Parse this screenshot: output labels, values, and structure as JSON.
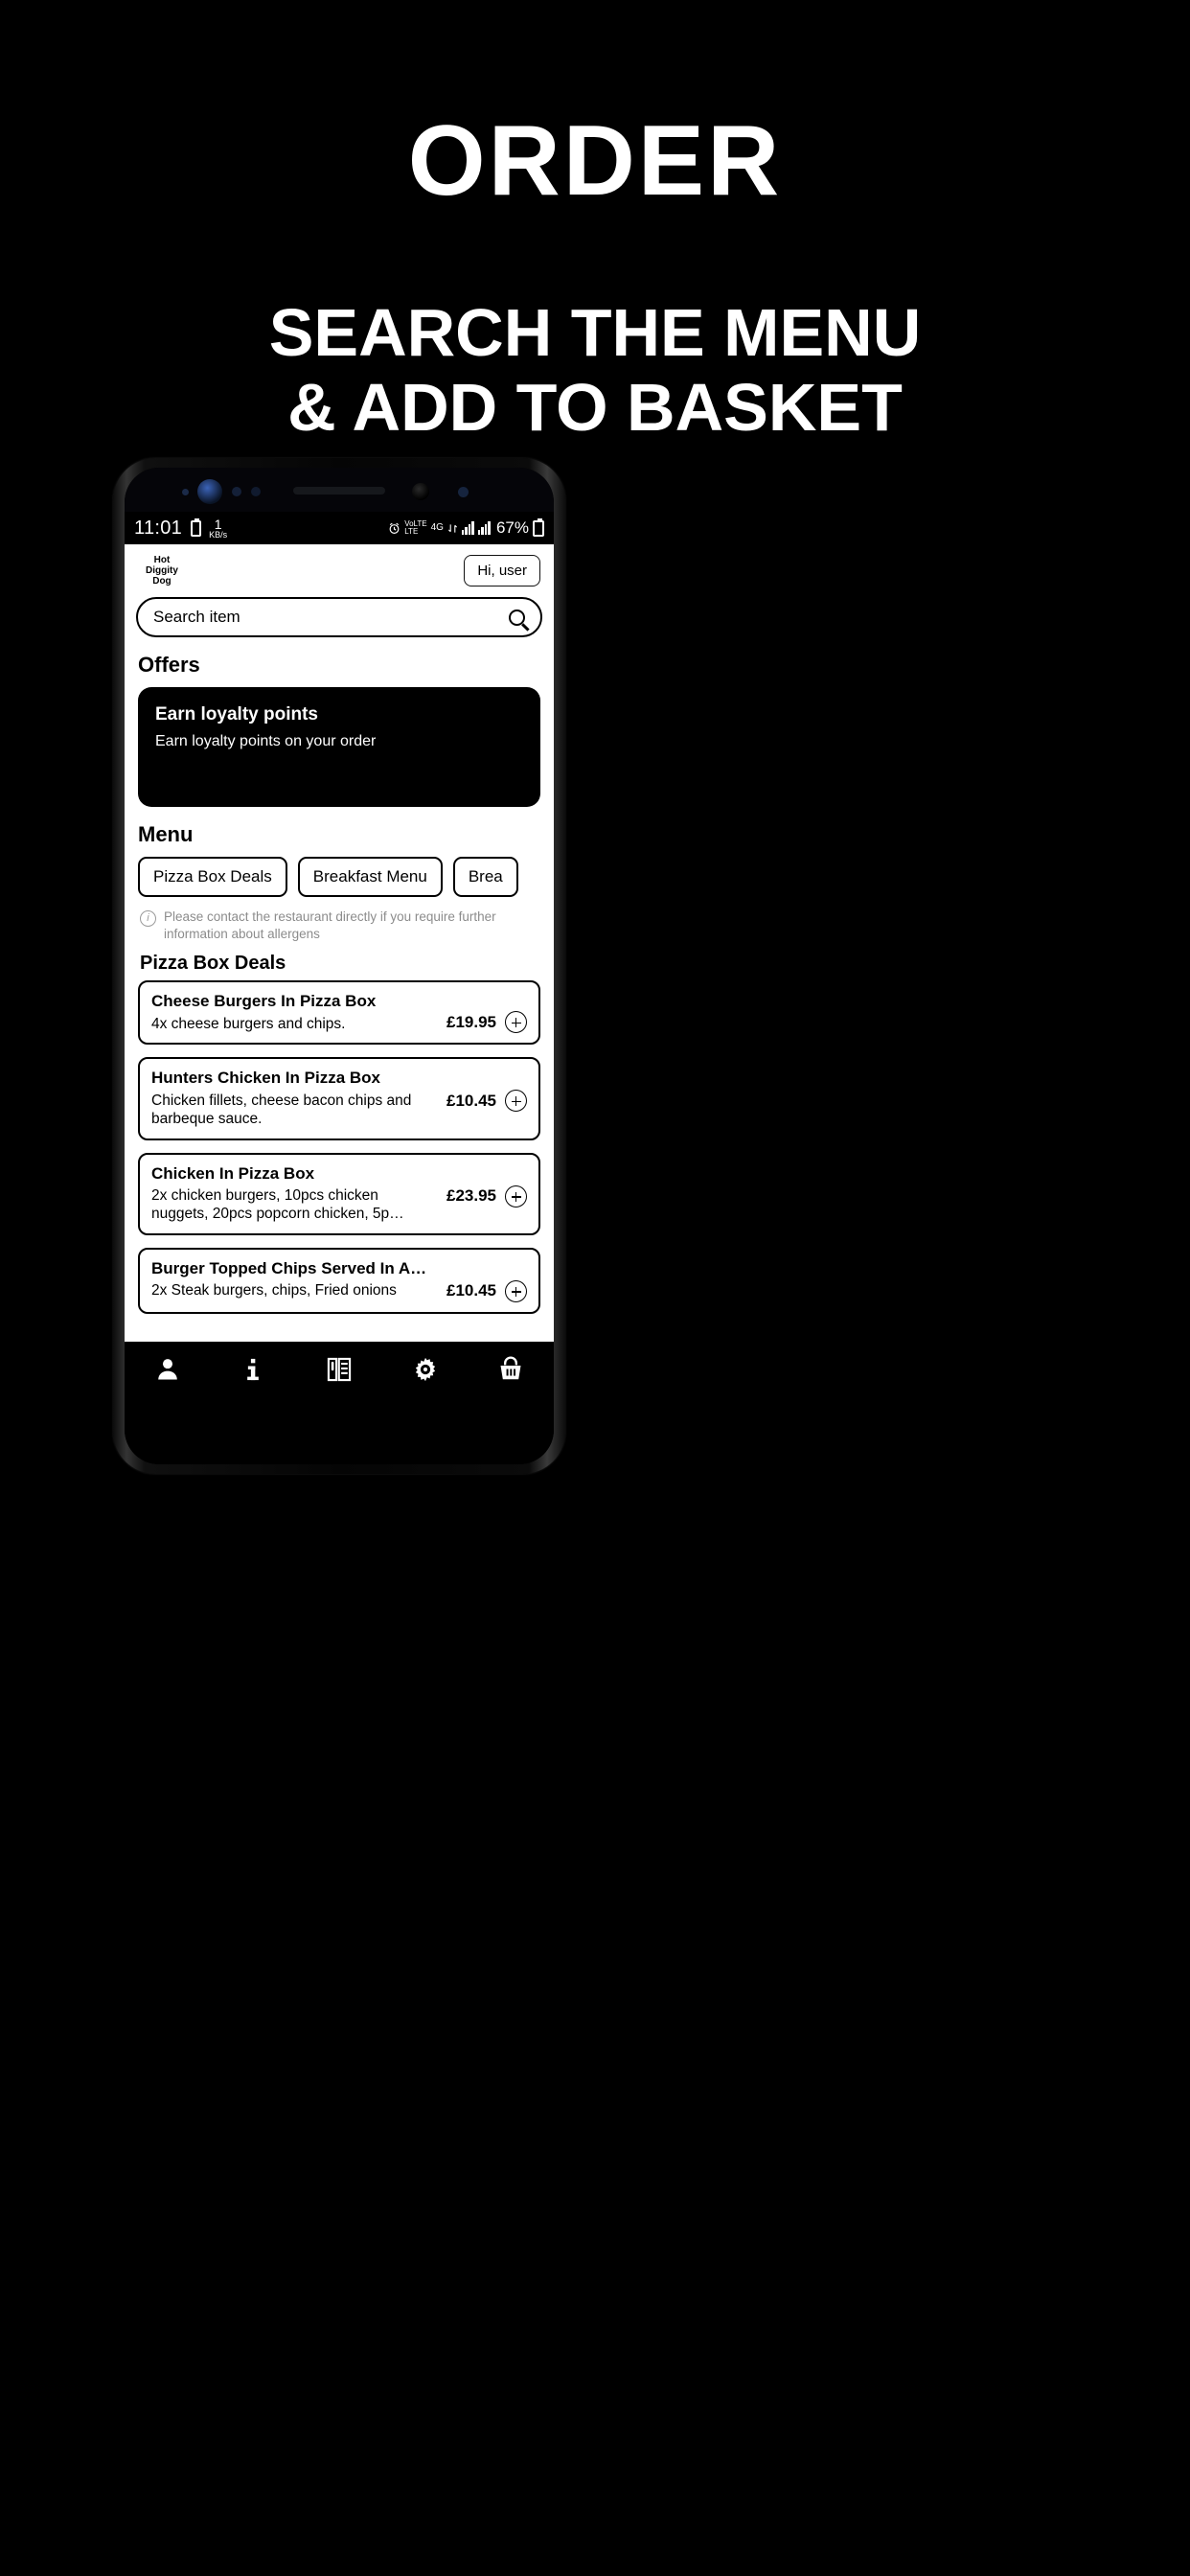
{
  "promo": {
    "title": "ORDER",
    "subtitle_line1": "SEARCH THE MENU",
    "subtitle_line2": "& ADD TO BASKET"
  },
  "status_bar": {
    "time": "11:01",
    "battery_icon": "battery-icon",
    "net_speed_value": "1",
    "net_speed_unit": "KB/s",
    "alarm_icon": "alarm-icon",
    "volte_line1": "VoLTE",
    "volte_line2": "LTE",
    "network_type": "4G",
    "data_arrows": "data-transfer-icon",
    "battery_percent": "67%"
  },
  "app": {
    "logo": {
      "line1": "Hot",
      "line2": "Diggity",
      "line3": "Dog"
    },
    "account_button": "Hi, user",
    "search": {
      "placeholder": "Search item",
      "value": "",
      "icon": "search-icon"
    },
    "offers": {
      "heading": "Offers",
      "card": {
        "title": "Earn loyalty points",
        "subtitle": "Earn loyalty points on your order"
      }
    },
    "menu": {
      "heading": "Menu",
      "chips": [
        "Pizza Box Deals",
        "Breakfast Menu",
        "Brea"
      ],
      "allergen_notice": "Please contact the restaurant directly if you require further information about allergens",
      "allergen_icon": "info-icon",
      "category_title": "Pizza Box Deals",
      "items": [
        {
          "name": "Cheese Burgers In Pizza Box",
          "description": "4x cheese burgers and chips.",
          "price": "£19.95",
          "add_icon": "plus-icon"
        },
        {
          "name": "Hunters Chicken In Pizza Box",
          "description": "Chicken fillets, cheese bacon chips and barbeque sauce.",
          "price": "£10.45",
          "add_icon": "plus-icon"
        },
        {
          "name": "Chicken In Pizza Box",
          "description": "2x chicken burgers, 10pcs chicken nuggets, 20pcs popcorn chicken, 5p…",
          "price": "£23.95",
          "add_icon": "plus-icon"
        },
        {
          "name": "Burger Topped Chips Served In A…",
          "description": "2x Steak burgers, chips, Fried onions",
          "price": "£10.45",
          "add_icon": "plus-icon"
        }
      ]
    },
    "tabbar": [
      {
        "name": "account",
        "icon": "person-icon"
      },
      {
        "name": "info",
        "icon": "info-letter-icon"
      },
      {
        "name": "menu",
        "icon": "menu-list-icon"
      },
      {
        "name": "settings",
        "icon": "gear-icon"
      },
      {
        "name": "basket",
        "icon": "basket-icon"
      }
    ]
  },
  "colors": {
    "background": "#000000",
    "surface": "#ffffff",
    "text": "#000000",
    "muted": "#8c8c8c"
  }
}
